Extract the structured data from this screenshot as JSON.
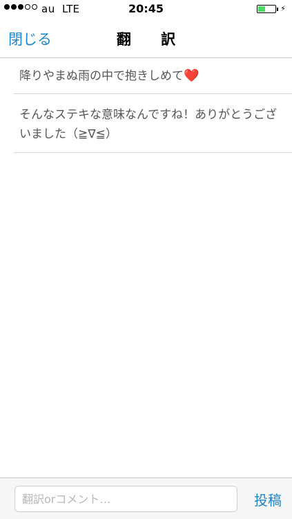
{
  "status_bar": {
    "carrier": "au",
    "network": "LTE",
    "time": "20:45",
    "signal_strength": 3,
    "signal_max": 5,
    "battery_level": 0.4,
    "battery_color": "#4cd964",
    "charging_icon": "lightning-bolt-icon"
  },
  "nav": {
    "close_label": "閉じる",
    "title": "翻 訳"
  },
  "messages": [
    {
      "text": "降りやまぬ雨の中で抱きしめて",
      "emoji": "❤️"
    },
    {
      "text": "そんなステキな意味なんですね！ありがとうございました（≧∇≦）"
    }
  ],
  "comment_bar": {
    "placeholder": "翻訳orコメント…",
    "value": "",
    "post_label": "投稿"
  },
  "colors": {
    "accent": "#1d86c8",
    "heart": "#e0192b"
  }
}
